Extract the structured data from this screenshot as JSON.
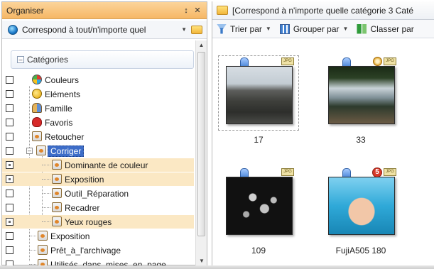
{
  "organiser": {
    "title": "Organiser",
    "pin": " ↕",
    "close": "✕",
    "match_text": "Correspond à tout/n'importe quel"
  },
  "categories": {
    "header": "Catégories",
    "items": [
      {
        "label": "Couleurs",
        "icon": "color-wheel-icon"
      },
      {
        "label": "Eléments",
        "icon": "element-icon"
      },
      {
        "label": "Famille",
        "icon": "family-icon"
      },
      {
        "label": "Favoris",
        "icon": "heart-icon"
      },
      {
        "label": "Retoucher",
        "icon": "tag-icon"
      },
      {
        "label": "Corriger",
        "icon": "tag-icon",
        "selected": true
      },
      {
        "label": "Dominante de couleur",
        "icon": "tag-icon"
      },
      {
        "label": "Exposition",
        "icon": "tag-icon"
      },
      {
        "label": "Outil_Réparation",
        "icon": "tag-icon"
      },
      {
        "label": "Recadrer",
        "icon": "tag-icon"
      },
      {
        "label": "Yeux rouges",
        "icon": "tag-icon"
      },
      {
        "label": "Exposition",
        "icon": "tag-icon"
      },
      {
        "label": "Prêt_à_l'archivage",
        "icon": "tag-icon"
      },
      {
        "label": "Utilisés_dans_mises_en_page",
        "icon": "tag-icon"
      }
    ]
  },
  "browser": {
    "path": "[Correspond à n'importe quelle catégorie 3 Caté",
    "toolbar": {
      "sort_label": "Trier par",
      "group_label": "Grouper par",
      "classify_label": "Classer par"
    },
    "thumbnails": [
      {
        "caption": "17",
        "badge": "JPG",
        "extra": ""
      },
      {
        "caption": "33",
        "badge": "JPG",
        "extra": "clock"
      },
      {
        "caption": "109",
        "badge": "JPG",
        "extra": ""
      },
      {
        "caption": "FujiA505 180",
        "badge": "JPG",
        "extra": "5"
      }
    ]
  }
}
